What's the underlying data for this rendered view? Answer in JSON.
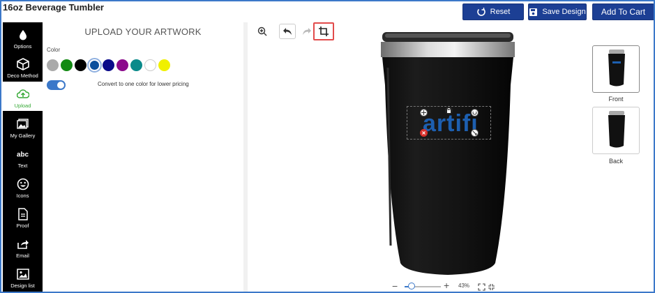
{
  "app": {
    "title": "16oz Beverage Tumbler"
  },
  "header": {
    "reset_label": "Reset",
    "save_label": "Save Design",
    "cart_label": "Add To Cart"
  },
  "sidebar": {
    "items": [
      {
        "label": "Options",
        "icon": "drop-icon"
      },
      {
        "label": "Deco Method",
        "icon": "box-icon"
      },
      {
        "label": "Upload",
        "icon": "cloud-upload-icon",
        "active": true
      },
      {
        "label": "My Gallery",
        "icon": "gallery-icon"
      },
      {
        "label": "Text",
        "icon": "text-abc-icon"
      },
      {
        "label": "Icons",
        "icon": "smiley-icon"
      },
      {
        "label": "Proof",
        "icon": "document-icon"
      },
      {
        "label": "Email",
        "icon": "share-icon"
      },
      {
        "label": "Design list",
        "icon": "image-list-icon"
      }
    ]
  },
  "panel": {
    "title": "UPLOAD YOUR ARTWORK",
    "color_label": "Color",
    "colors": [
      "#aaaaaa",
      "#138a13",
      "#000000",
      "#0b4f9c",
      "#0a0a8a",
      "#8b0a8b",
      "#0a8a8a",
      "#ffffff",
      "#f0f000"
    ],
    "selected_color": "#0b4f9c",
    "toggle_label": "Convert to one color for lower pricing",
    "toggle_on": true
  },
  "canvas": {
    "artwork_text": "artifi",
    "artwork_color": "#1d5fb0"
  },
  "views": {
    "front_label": "Front",
    "back_label": "Back"
  },
  "zoom": {
    "minus": "−",
    "plus": "+",
    "value": "43%"
  }
}
